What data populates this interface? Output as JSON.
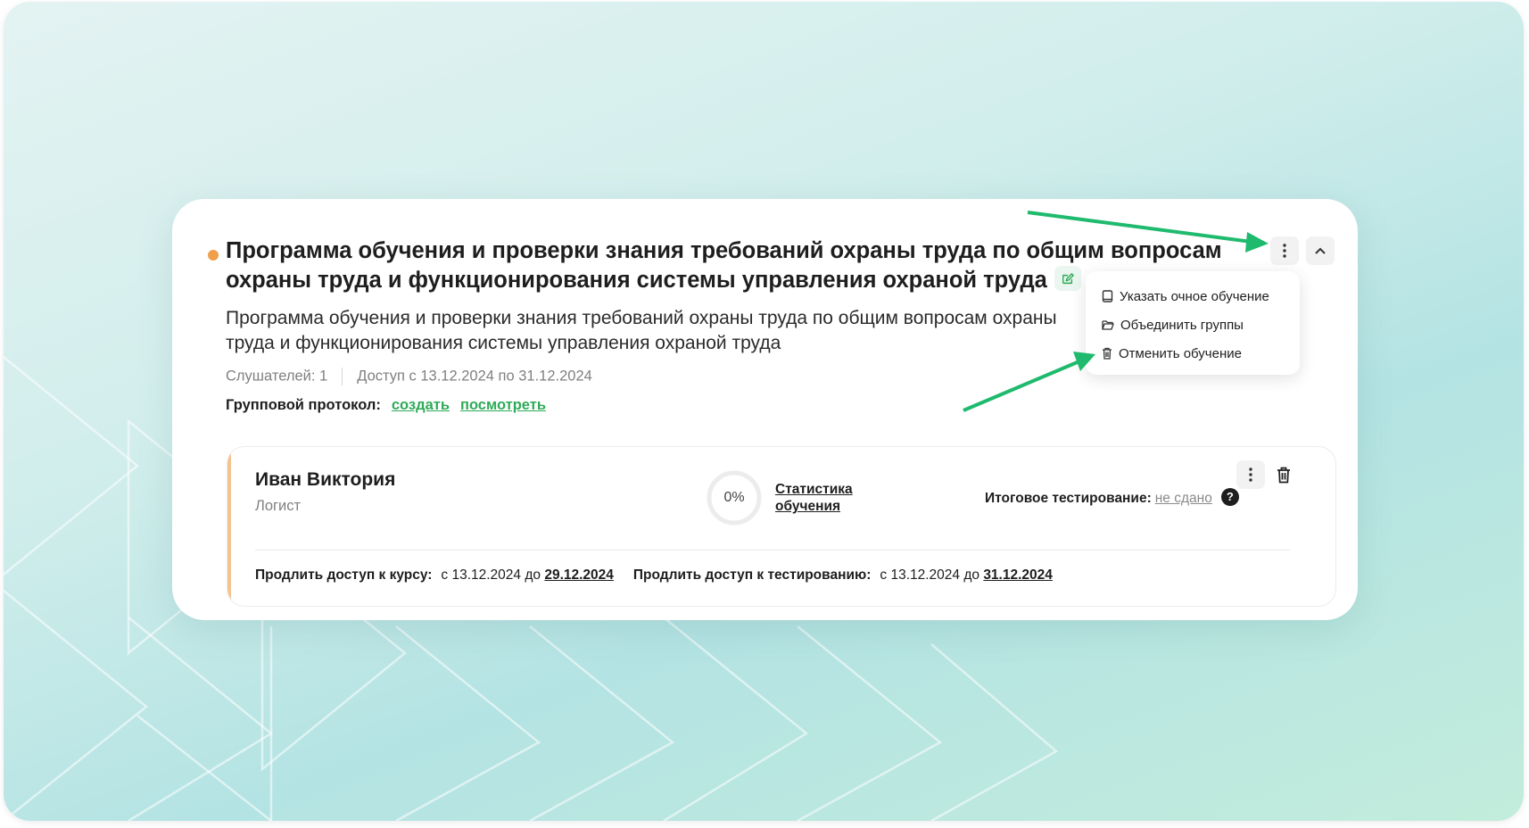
{
  "course": {
    "title": "Программа обучения и проверки знания требований охраны труда по общим вопросам охраны труда и функционирования системы управления охраной труда",
    "description": "Программа обучения и проверки знания требований охраны труда по общим вопросам охраны труда и функционирования системы управления охраной труда",
    "listeners": "Слушателей: 1",
    "access": "Доступ с 13.12.2024 по 31.12.2024",
    "protocol_label": "Групповой протокол:",
    "protocol_create": "создать",
    "protocol_view": "посмотреть",
    "status_color": "#f0a04b",
    "accent_color": "#2eaa58"
  },
  "menu": {
    "items": [
      {
        "label": "Указать очное обучение",
        "icon": "book-icon"
      },
      {
        "label": "Объединить группы",
        "icon": "folder-icon"
      },
      {
        "label": "Отменить обучение",
        "icon": "trash-icon"
      }
    ]
  },
  "student": {
    "name": "Иван Виктория",
    "role": "Логист",
    "progress_label": "0%",
    "progress": 0,
    "stats_link": "Статистика обучения",
    "final_test_label": "Итоговое тестирование:",
    "final_test_status": "не сдано",
    "help": "?",
    "course_access_label": "Продлить доступ к курсу:",
    "course_access_from": "с 13.12.2024 до",
    "course_access_to": "29.12.2024",
    "test_access_label": "Продлить доступ к тестированию:",
    "test_access_from": "с 13.12.2024 до",
    "test_access_to": "31.12.2024"
  }
}
